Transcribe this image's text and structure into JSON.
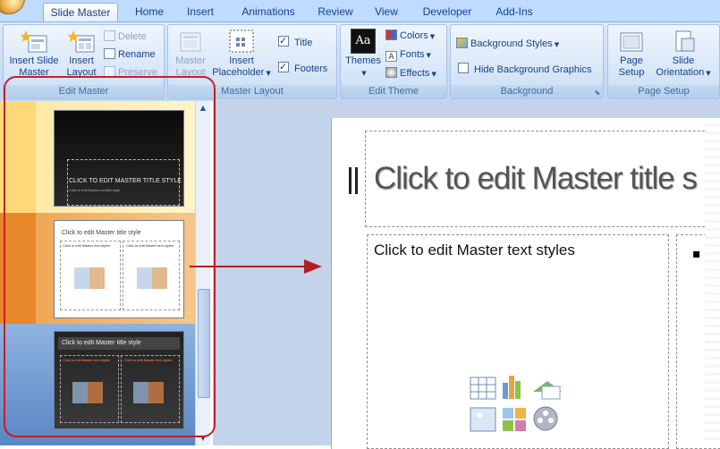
{
  "tabs": [
    {
      "label": "Slide Master",
      "active": true
    },
    {
      "label": "Home",
      "active": false
    },
    {
      "label": "Insert",
      "active": false
    },
    {
      "label": "Animations",
      "active": false
    },
    {
      "label": "Review",
      "active": false
    },
    {
      "label": "View",
      "active": false
    },
    {
      "label": "Developer",
      "active": false
    },
    {
      "label": "Add-Ins",
      "active": false
    }
  ],
  "ribbon": {
    "edit_master": {
      "label": "Edit Master",
      "insert_slide_master": [
        "Insert Slide",
        "Master"
      ],
      "insert_layout": [
        "Insert",
        "Layout"
      ],
      "delete": "Delete",
      "rename": "Rename",
      "preserve": "Preserve"
    },
    "master_layout": {
      "label": "Master Layout",
      "master_layout_btn": [
        "Master",
        "Layout"
      ],
      "insert_placeholder": [
        "Insert",
        "Placeholder"
      ],
      "title_check": "Title",
      "footers_check": "Footers",
      "title_checked": true,
      "footers_checked": true
    },
    "edit_theme": {
      "label": "Edit Theme",
      "themes": "Themes",
      "themes_icon_text": "Aa",
      "colors": "Colors",
      "fonts": "Fonts",
      "effects": "Effects"
    },
    "background": {
      "label": "Background",
      "background_styles": "Background Styles",
      "hide_background_graphics": "Hide Background Graphics",
      "hide_checked": false
    },
    "page_setup": {
      "label": "Page Setup",
      "page_setup_btn": [
        "Page",
        "Setup"
      ],
      "slide_orientation": [
        "Slide",
        "Orientation"
      ]
    }
  },
  "thumbnails": [
    {
      "title": "CLICK TO EDIT MASTER TITLE STYLE",
      "subtitle": "Click to edit Master subtitle style",
      "theme": "dark"
    },
    {
      "title": "Click to edit Master title style",
      "left_text": "Click to edit Master text styles",
      "right_text": "Click to edit Master text styles",
      "theme": "light"
    },
    {
      "title": "Click to edit Master title style",
      "left_text": "Click to edit Master text styles",
      "right_text": "Click to edit Master text styles",
      "theme": "dark"
    }
  ],
  "slide": {
    "title": "Click to edit Master title s",
    "body_text": "Click to edit Master text styles",
    "bullet": "▪"
  },
  "colors": {
    "annotation_red": "#c3202a",
    "ribbon_blue": "#bfdbff",
    "text_blue": "#15428b"
  }
}
